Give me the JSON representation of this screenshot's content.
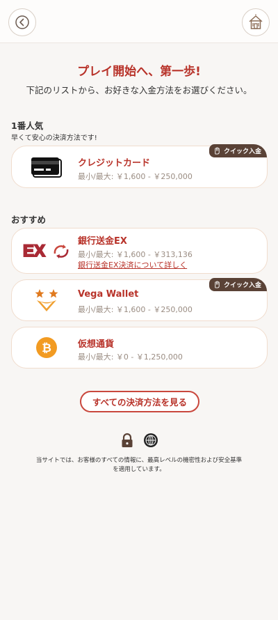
{
  "header": {
    "back_icon": "chevron-left-icon",
    "home_icon": "home-icon"
  },
  "intro": {
    "title": "プレイ開始へ、第一歩!",
    "subtitle": "下記のリストから、お好きな入金方法をお選びください。"
  },
  "popular": {
    "title": "1番人気",
    "subtitle": "早くて安心の決済方法です!",
    "methods": [
      {
        "name": "クレジットカード",
        "limits": "最小/最大: ￥1,600 - ￥250,000",
        "badge": "クイック入金",
        "icon": "credit-card-icon"
      }
    ]
  },
  "recommended": {
    "title": "おすすめ",
    "methods": [
      {
        "name": "銀行送金EX",
        "limits": "最小/最大: ￥1,600 - ￥313,136",
        "link": "銀行送金EX決済について詳しく",
        "icon": "bank-transfer-ex-icon"
      },
      {
        "name": "Vega Wallet",
        "limits": "最小/最大: ￥1,600 - ￥250,000",
        "badge": "クイック入金",
        "icon": "vega-wallet-icon"
      },
      {
        "name": "仮想通貨",
        "limits": "最小/最大: ￥0 - ￥1,250,000",
        "icon": "bitcoin-icon"
      }
    ]
  },
  "see_all_label": "すべての決済方法を見る",
  "footer": {
    "security_text": "当サイトでは、お客様のすべての情報に、最高レベルの機密性および安全基準を適用しています。",
    "icons": [
      "lock-icon",
      "globe-icon"
    ]
  },
  "colors": {
    "accent": "#b8332a",
    "badge": "#5a4236",
    "background": "#f8f6f4"
  }
}
